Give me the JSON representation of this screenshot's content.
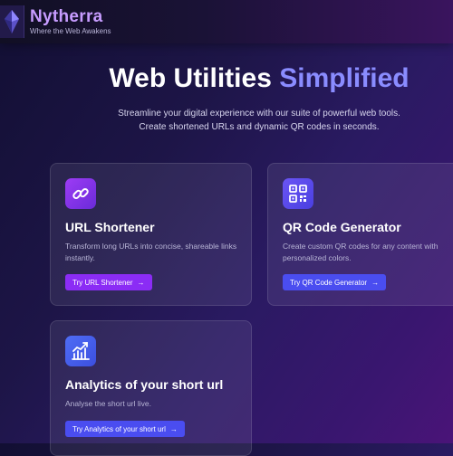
{
  "brand": {
    "name": "Nytherra",
    "tagline": "Where the Web Awakens"
  },
  "hero": {
    "title_main": "Web Utilities",
    "title_accent": "Simplified",
    "subtitle": "Streamline your digital experience with our suite of powerful web tools. Create shortened URLs and dynamic QR codes in seconds."
  },
  "cards": [
    {
      "title": "URL Shortener",
      "description": "Transform long URLs into concise, shareable links instantly.",
      "button": "Try URL Shortener",
      "icon": "link-icon"
    },
    {
      "title": "QR Code Generator",
      "description": "Create custom QR codes for any content with personalized colors.",
      "button": "Try QR Code Generator",
      "icon": "qr-code-icon"
    },
    {
      "title": "Analytics of your short url",
      "description": "Analyse the short url live.",
      "button": "Try Analytics of your short url",
      "icon": "bar-chart-icon"
    }
  ],
  "icons": {
    "arrow": "→"
  },
  "colors": {
    "brand": "#c79cff",
    "accent": "#8a8cff",
    "button_purple": "#8b2cf5",
    "button_blue": "#4a4df0"
  }
}
